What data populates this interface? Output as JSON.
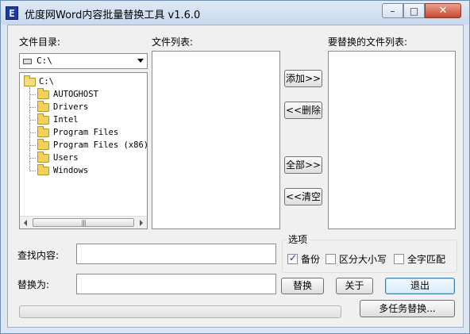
{
  "window": {
    "title": "优度网Word内容批量替换工具 v1.6.0",
    "app_icon_glyph": "E",
    "controls": {
      "minimize": "–",
      "maximize": "□",
      "close": "✕"
    }
  },
  "labels": {
    "directory": "文件目录:",
    "file_list": "文件列表:",
    "replace_list": "要替换的文件列表:",
    "find": "查找内容:",
    "replace_with": "替换为:",
    "options": "选项"
  },
  "drive_combo": {
    "value": "C:\\"
  },
  "tree": {
    "root": "C:\\",
    "folders": [
      "AUTOGHOST",
      "Drivers",
      "Intel",
      "Program Files",
      "Program Files (x86)",
      "Users",
      "Windows"
    ]
  },
  "scrollbar": {
    "grip": "|||"
  },
  "buttons": {
    "add": "添加>>",
    "delete": "<<删除",
    "all": "全部>>",
    "clear": "<<清空",
    "replace": "替换",
    "about": "关于",
    "exit": "退出",
    "multitask": "多任务替换..."
  },
  "options": {
    "backup": {
      "label": "备份",
      "checked": true
    },
    "case_sensitive": {
      "label": "区分大小写",
      "checked": false
    },
    "whole_word": {
      "label": "全字匹配",
      "checked": false
    }
  },
  "inputs": {
    "find_value": "",
    "replace_value": ""
  },
  "progress": {
    "fraction": 0
  }
}
